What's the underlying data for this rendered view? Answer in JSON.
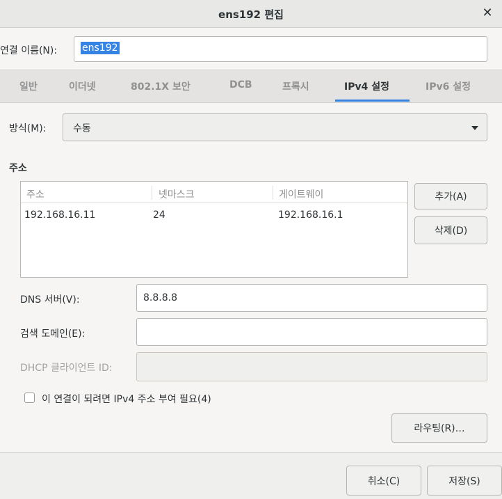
{
  "window": {
    "title": "ens192 편집"
  },
  "connection": {
    "name_label": "연결 이름(N):",
    "name_value": "ens192"
  },
  "tabs": [
    {
      "label": "일반",
      "active": false
    },
    {
      "label": "이더넷",
      "active": false
    },
    {
      "label": "802.1X 보안",
      "active": false
    },
    {
      "label": "DCB",
      "active": false
    },
    {
      "label": "프록시",
      "active": false
    },
    {
      "label": "IPv4 설정",
      "active": true
    },
    {
      "label": "IPv6 설정",
      "active": false
    }
  ],
  "method": {
    "label": "방식(M):",
    "value": "수동"
  },
  "addresses": {
    "section_title": "주소",
    "columns": [
      "주소",
      "넷마스크",
      "게이트웨이"
    ],
    "rows": [
      [
        "192.168.16.11",
        "24",
        "192.168.16.1"
      ]
    ],
    "add_label": "추가(A)",
    "delete_label": "삭제(D)"
  },
  "dns": {
    "label": "DNS 서버(V):",
    "value": "8.8.8.8"
  },
  "search_domains": {
    "label": "검색 도메인(E):",
    "value": ""
  },
  "dhcp_client_id": {
    "label": "DHCP 클라이언트 ID:",
    "value": ""
  },
  "require_ipv4": {
    "label": "이 연결이 되려면 IPv4 주소 부여 필요(4)",
    "checked": false
  },
  "routes_label": "라우팅(R)…",
  "footer": {
    "cancel_label": "취소(C)",
    "save_label": "저장(S)"
  },
  "colors": {
    "accent": "#3584e4",
    "window_bg": "#f6f5f4"
  }
}
